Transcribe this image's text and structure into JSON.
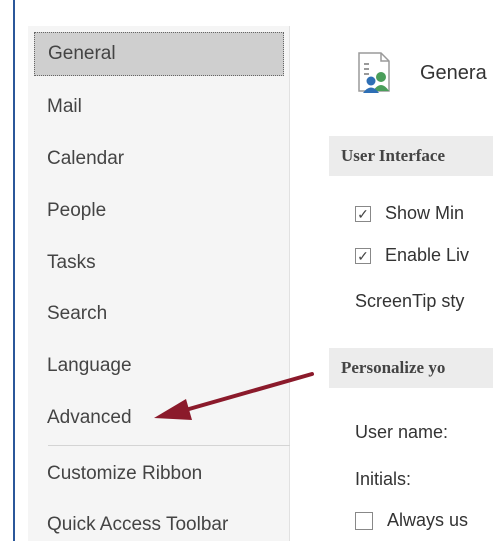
{
  "sidebar": {
    "items": [
      {
        "label": "General",
        "selected": true
      },
      {
        "label": "Mail"
      },
      {
        "label": "Calendar"
      },
      {
        "label": "People"
      },
      {
        "label": "Tasks"
      },
      {
        "label": "Search"
      },
      {
        "label": "Language"
      },
      {
        "label": "Advanced"
      },
      {
        "label": "Customize Ribbon"
      },
      {
        "label": "Quick Access Toolbar"
      }
    ]
  },
  "content": {
    "header_title": "Genera",
    "sections": {
      "user_interface": "User Interface",
      "personalize": "Personalize yo"
    },
    "options": {
      "show_mini": {
        "label": "Show Min",
        "checked": true
      },
      "enable_live": {
        "label": "Enable Liv",
        "checked": true
      },
      "screentip": "ScreenTip sty",
      "user_name": "User name:",
      "initials": "Initials:",
      "always_use": {
        "label": "Always us",
        "checked": false
      }
    }
  },
  "colors": {
    "accent": "#2b579a",
    "arrow": "#8b1a2b",
    "selected_bg": "#cfcfcf"
  },
  "icons": {
    "header": "general-options-icon",
    "arrow": "annotation-arrow"
  }
}
